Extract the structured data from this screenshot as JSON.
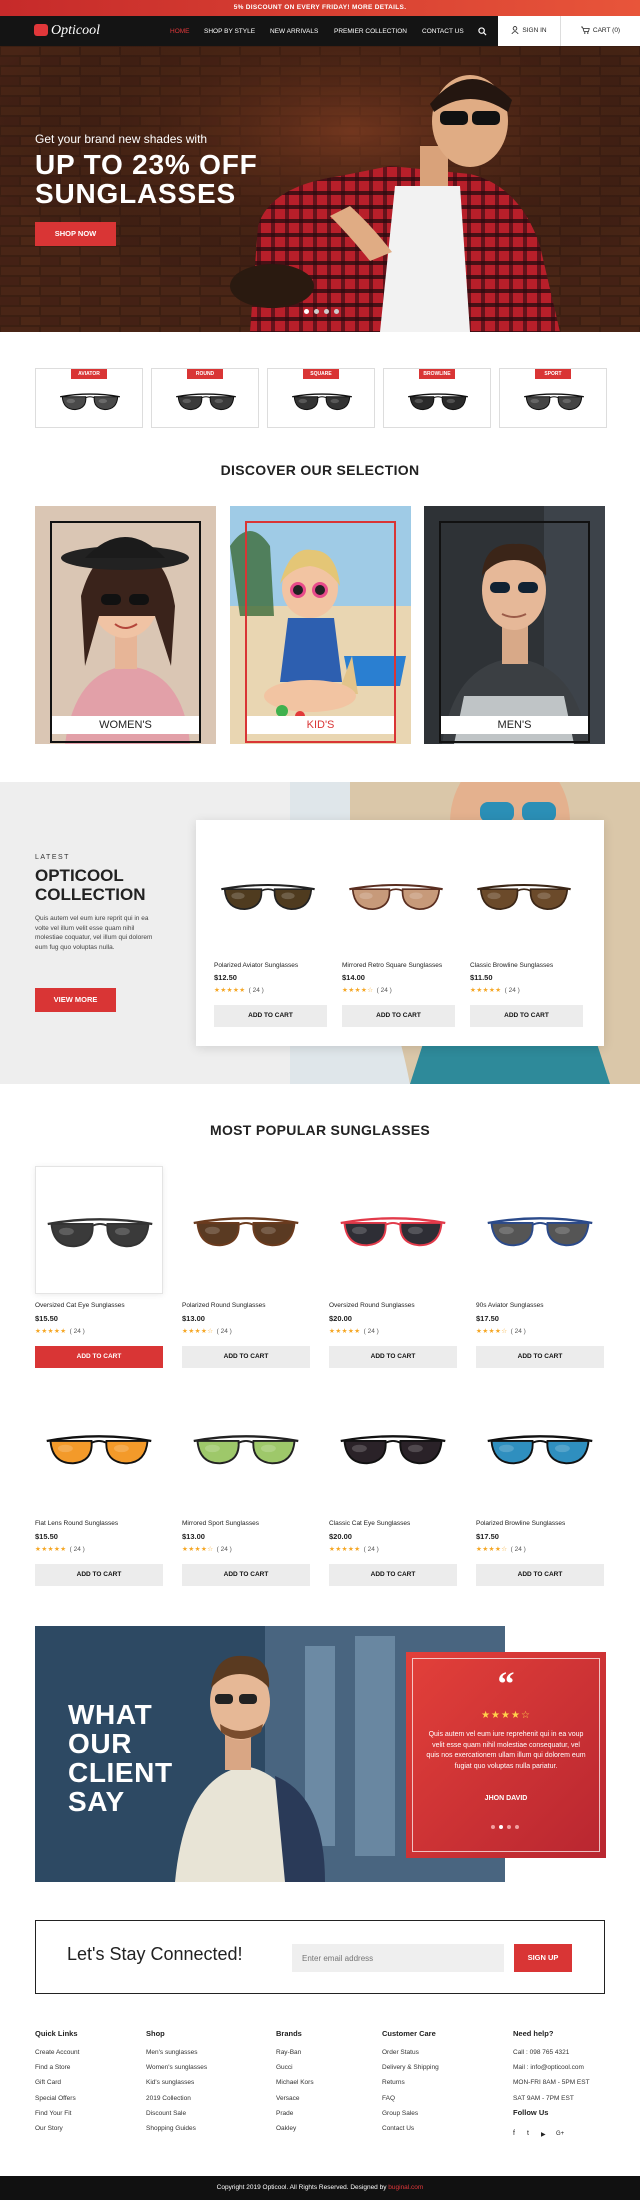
{
  "topbar": {
    "text": "5% DISCOUNT ON EVERY FRIDAY! MORE DETAILS."
  },
  "header": {
    "logo": "Opticool",
    "nav": [
      "HOME",
      "SHOP BY STYLE",
      "NEW ARRIVALS",
      "PREMIER COLLECTION",
      "CONTACT US"
    ],
    "active_nav": "HOME",
    "signin": "SIGN IN",
    "cart": "CART (0)"
  },
  "hero": {
    "subtitle": "Get your brand new shades with",
    "title_line1": "UP TO 23% OFF",
    "title_line2": "SUNGLASSES",
    "button": "SHOP NOW",
    "slides": 4,
    "active_slide": 1
  },
  "categories": [
    "AVIATOR",
    "ROUND",
    "SQUARE",
    "BROWLINE",
    "SPORT"
  ],
  "selection": {
    "title": "DISCOVER OUR SELECTION",
    "items": [
      "WOMEN'S",
      "KID'S",
      "MEN'S"
    ]
  },
  "latest": {
    "eyebrow": "LATEST",
    "title_line1": "OPTICOOL",
    "title_line2": "COLLECTION",
    "text": "Quis autem vel eum iure reprit qui in ea volte vel illum velit esse quam nihil molestiae coquatur, vel illum qui dolorem eum fug quo voluptas nulla.",
    "button": "VIEW MORE",
    "products": [
      {
        "name": "Polarized Aviator Sunglasses",
        "price": "$12.50",
        "count": "( 24 )",
        "stars": 5,
        "button": "ADD TO CART"
      },
      {
        "name": "Mirrored Retro Square Sunglasses",
        "price": "$14.00",
        "count": "( 24 )",
        "stars": 4,
        "button": "ADD TO CART"
      },
      {
        "name": "Classic Browline Sunglasses",
        "price": "$11.50",
        "count": "( 24 )",
        "stars": 5,
        "button": "ADD TO CART"
      }
    ]
  },
  "popular": {
    "title": "MOST POPULAR SUNGLASSES",
    "products": [
      {
        "name": "Oversized Cat Eye Sunglasses",
        "price": "$15.50",
        "count": "( 24 )",
        "stars": 5,
        "button": "ADD TO CART",
        "lens": "#3a3a3a",
        "frame": "#333333"
      },
      {
        "name": "Polarized Round Sunglasses",
        "price": "$13.00",
        "count": "( 24 )",
        "stars": 4,
        "button": "ADD TO CART",
        "lens": "#5a3a22",
        "frame": "#6b3b1e"
      },
      {
        "name": "Oversized Round Sunglasses",
        "price": "$20.00",
        "count": "( 24 )",
        "stars": 5,
        "button": "ADD TO CART",
        "lens": "#2e2e35",
        "frame": "#e23a4a"
      },
      {
        "name": "90s Aviator Sunglasses",
        "price": "$17.50",
        "count": "( 24 )",
        "stars": 4,
        "button": "ADD TO CART",
        "lens": "#555555",
        "frame": "#2b4a8a"
      },
      {
        "name": "Flat Lens Round Sunglasses",
        "price": "$15.50",
        "count": "( 24 )",
        "stars": 5,
        "button": "ADD TO CART",
        "lens": "#f39a2a",
        "frame": "#111111"
      },
      {
        "name": "Mirrored Sport Sunglasses",
        "price": "$13.00",
        "count": "( 24 )",
        "stars": 4,
        "button": "ADD TO CART",
        "lens": "#9ec86a",
        "frame": "#222222"
      },
      {
        "name": "Classic Cat Eye Sunglasses",
        "price": "$20.00",
        "count": "( 24 )",
        "stars": 5,
        "button": "ADD TO CART",
        "lens": "#2a2228",
        "frame": "#111111"
      },
      {
        "name": "Polarized Browline Sunglasses",
        "price": "$17.50",
        "count": "( 24 )",
        "stars": 4,
        "button": "ADD TO CART",
        "lens": "#2f8fbf",
        "frame": "#111111"
      }
    ]
  },
  "testimonial": {
    "title_line1": "WHAT",
    "title_line2": "OUR",
    "title_line3": "CLIENT",
    "title_line4": "SAY",
    "stars": "★★★★☆",
    "text": "Quis autem vel eum iure reprehenit qui in ea voup velit esse quam nihil molestiae consequatur, vel quis nos exercationem ullam illum qui dolorem eum fugiat quo voluptas nulla pariatur.",
    "author": "JHON DAVID"
  },
  "newsletter": {
    "title": "Let's Stay Connected!",
    "placeholder": "Enter email address",
    "button": "SIGN UP"
  },
  "footer": {
    "quick_links": {
      "title": "Quick Links",
      "items": [
        "Create Account",
        "Find a Store",
        "Gift Card",
        "Special Offers",
        "Find Your Fit",
        "Our Story"
      ]
    },
    "shop": {
      "title": "Shop",
      "items": [
        "Men's sunglasses",
        "Women's sunglasses",
        "Kid's sunglasses",
        "2019 Collection",
        "Discount Sale",
        "Shopping Guides"
      ]
    },
    "brands": {
      "title": "Brands",
      "items": [
        "Ray-Ban",
        "Gucci",
        "Michael Kors",
        "Versace",
        "Prade",
        "Oakley"
      ]
    },
    "care": {
      "title": "Customer Care",
      "items": [
        "Order Status",
        "Delivery & Shipping",
        "Returns",
        "FAQ",
        "Group Sales",
        "Contact Us"
      ]
    },
    "help": {
      "title": "Need help?",
      "items": [
        "Call : 098 765 4321",
        "Mail : info@opticool.com",
        "MON-FRI 8AM - 5PM EST",
        "SAT 9AM - 7PM EST"
      ]
    },
    "follow": {
      "title": "Follow Us",
      "icons": [
        "f",
        "t",
        "▶",
        "G+"
      ]
    },
    "copyright": "Copyright 2019 Opticool. All Rights Reserved. Designed by",
    "designer": "buginal.com"
  }
}
